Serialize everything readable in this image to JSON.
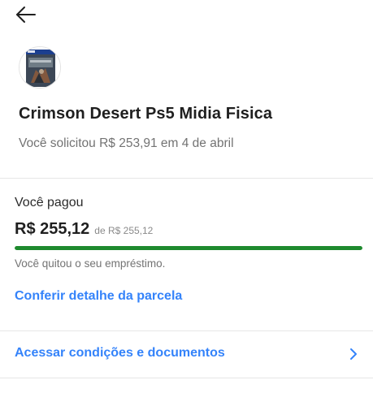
{
  "header": {
    "back_icon": "arrow-left-icon"
  },
  "product": {
    "thumbnail_icon": "game-cover-thumbnail",
    "title": "Crimson Desert Ps5 Midia Fisica",
    "request_text": "Você solicitou R$ 253,91 em 4 de abril"
  },
  "payment": {
    "paid_label": "Você pagou",
    "amount_paid": "R$ 255,12",
    "amount_total": "de R$ 255,12",
    "progress_fraction": 1.0,
    "status": "Você quitou o seu empréstimo.",
    "installment_link": "Conferir detalhe da parcela"
  },
  "conditions": {
    "label": "Acessar condições e documentos",
    "chevron_icon": "chevron-right-icon"
  },
  "colors": {
    "accent_link": "#3483fa",
    "progress_green": "#1e8a2e",
    "divider": "#e6e6e6"
  }
}
